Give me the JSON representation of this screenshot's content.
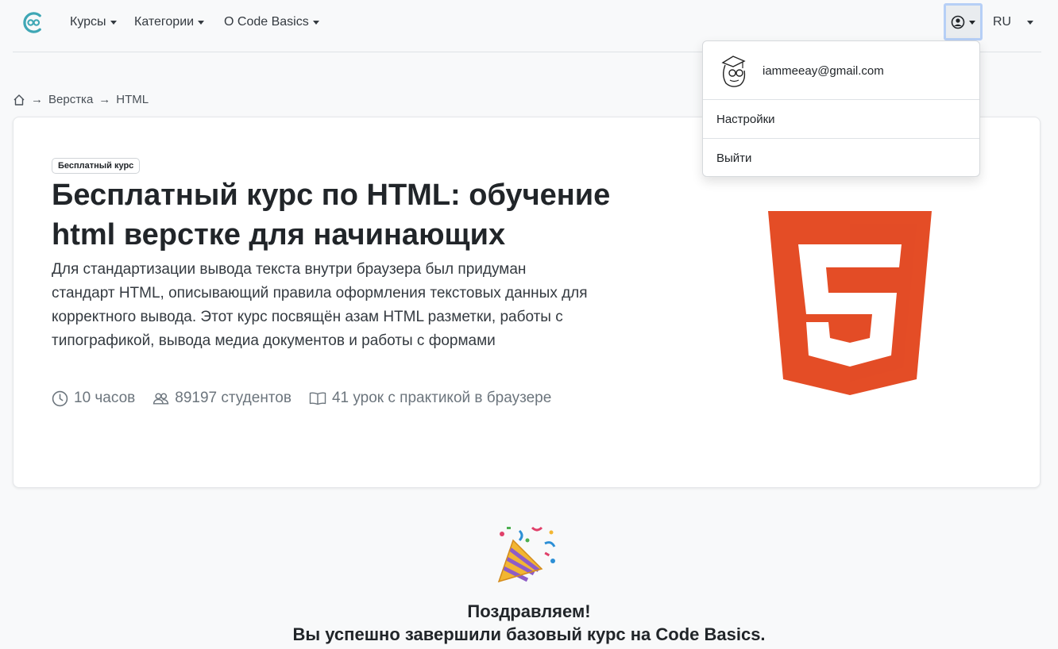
{
  "nav": {
    "items": [
      {
        "label": "Курсы"
      },
      {
        "label": "Категории"
      },
      {
        "label": "О Code Basics"
      }
    ],
    "lang": "RU",
    "accent_color": "#3fa7b5",
    "user_icon": "user-circle-icon"
  },
  "user_menu": {
    "email": "iammeeay@gmail.com",
    "settings": "Настройки",
    "logout": "Выйти"
  },
  "breadcrumb": {
    "home_icon": "home-icon",
    "items": [
      "Верстка",
      "HTML"
    ],
    "separator": "→"
  },
  "course": {
    "badge": "Бесплатный курс",
    "title": "Бесплатный курс по HTML: обучение html верстке для начинающих",
    "description": "Для стандартизации вывода текста внутри браузера был придуман стандарт HTML, описывающий правила оформления текстовых данных для корректного вывода. Этот курс посвящён азам HTML разметки, работы с типографикой, вывода медиа документов и работы с формами",
    "stats": {
      "duration": "10 часов",
      "students": "89197 студентов",
      "lessons": "41 урок с практикой в браузере"
    },
    "logo_color": "#e44d26",
    "logo_icon": "html5-logo"
  },
  "congrats": {
    "icon": "party-popper-icon",
    "line1": "Поздравляем!",
    "line2": "Вы успешно завершили базовый курс на Code Basics."
  }
}
